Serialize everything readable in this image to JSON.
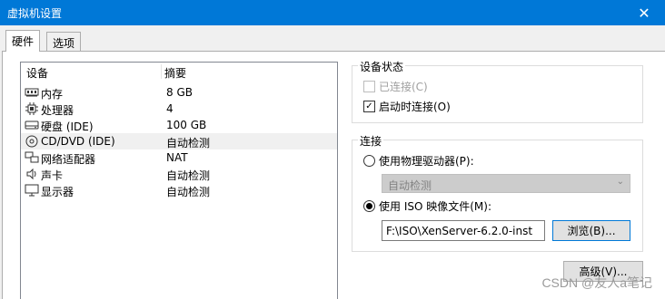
{
  "window": {
    "title": "虚拟机设置",
    "close_glyph": "✕"
  },
  "tabs": [
    {
      "label": "硬件",
      "active": true
    },
    {
      "label": "选项",
      "active": false
    }
  ],
  "device_list": {
    "col_device": "设备",
    "col_summary": "摘要",
    "rows": [
      {
        "icon": "memory-icon",
        "device": "内存",
        "summary": "8 GB"
      },
      {
        "icon": "processor-icon",
        "device": "处理器",
        "summary": "4"
      },
      {
        "icon": "harddisk-icon",
        "device": "硬盘 (IDE)",
        "summary": "100 GB"
      },
      {
        "icon": "cd-dvd-icon",
        "device": "CD/DVD (IDE)",
        "summary": "自动检测",
        "selected": true
      },
      {
        "icon": "network-adapter-icon",
        "device": "网络适配器",
        "summary": "NAT"
      },
      {
        "icon": "sound-card-icon",
        "device": "声卡",
        "summary": "自动检测"
      },
      {
        "icon": "display-icon",
        "device": "显示器",
        "summary": "自动检测"
      }
    ]
  },
  "device_status": {
    "title": "设备状态",
    "connected_label": "已连接(C)",
    "connected_checked": false,
    "connected_disabled": true,
    "connect_at_power_on_label": "启动时连接(O)",
    "connect_at_power_on_checked": true
  },
  "connection": {
    "title": "连接",
    "physical_drive_label": "使用物理驱动器(P):",
    "physical_drive_selected": false,
    "physical_drive_value": "自动检测",
    "iso_label": "使用 ISO 映像文件(M):",
    "iso_selected": true,
    "iso_path": "F:\\ISO\\XenServer-6.2.0-inst",
    "browse_label": "浏览(B)..."
  },
  "advanced_label": "高级(V)...",
  "watermark": "CSDN @友人a笔记"
}
